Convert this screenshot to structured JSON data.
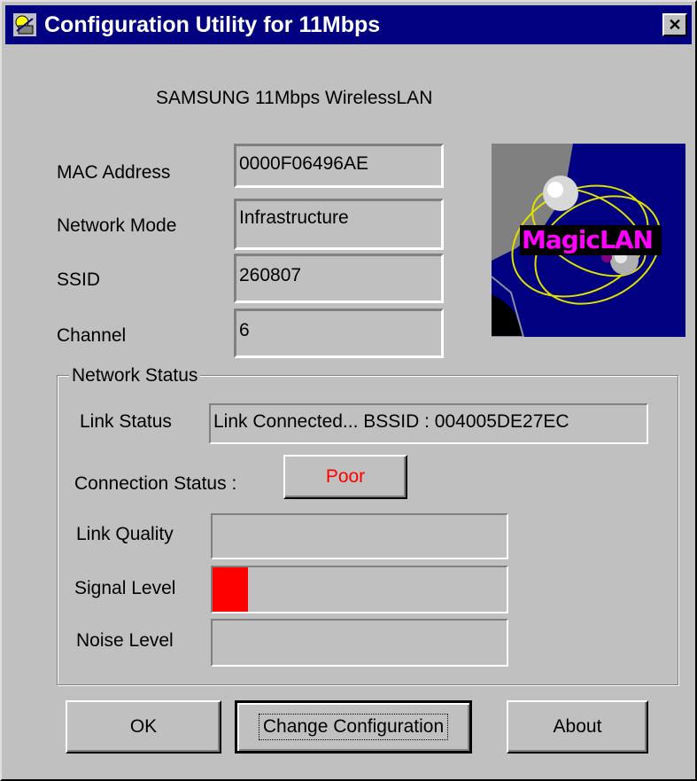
{
  "window": {
    "title": "Configuration Utility for 11Mbps",
    "close_glyph": "✕"
  },
  "product_name": "SAMSUNG 11Mbps WirelessLAN",
  "fields": [
    {
      "label": "MAC Address",
      "value": "0000F06496AE"
    },
    {
      "label": "Network Mode",
      "value": "Infrastructure"
    },
    {
      "label": "SSID",
      "value": "260807"
    },
    {
      "label": "Channel",
      "value": "6"
    }
  ],
  "logo": {
    "text": "MagicLAN",
    "icon": "magiclan-logo",
    "text_color": "#ff00ff"
  },
  "network_status": {
    "title": "Network Status",
    "link_status_label": "Link Status",
    "link_status_value": "Link Connected... BSSID : 004005DE27EC",
    "connection_status_label": "Connection Status :",
    "connection_status_value": "Poor",
    "connection_status_color": "#ff0000",
    "meters": [
      {
        "label": "Link Quality",
        "level": 0
      },
      {
        "label": "Signal Level",
        "level": 0.12
      },
      {
        "label": "Noise Level",
        "level": 0
      }
    ]
  },
  "buttons": {
    "ok": "OK",
    "change_configuration": "Change Configuration",
    "about": "About"
  }
}
